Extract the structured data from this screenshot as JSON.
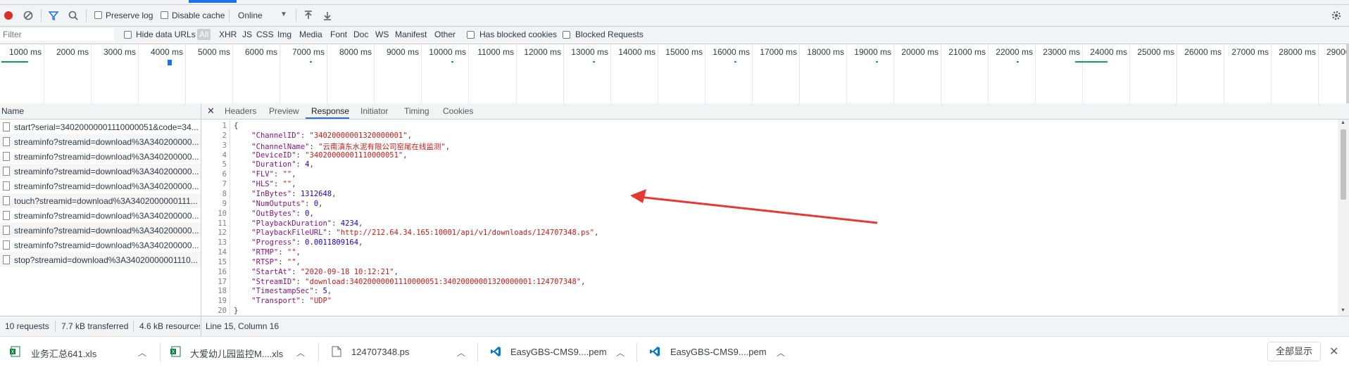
{
  "toolbar": {
    "preserve_log": "Preserve log",
    "disable_cache": "Disable cache",
    "throttle": "Online"
  },
  "filterbar": {
    "filter_placeholder": "Filter",
    "hide_data_urls": "Hide data URLs",
    "types": [
      "All",
      "XHR",
      "JS",
      "CSS",
      "Img",
      "Media",
      "Font",
      "Doc",
      "WS",
      "Manifest",
      "Other"
    ],
    "blocked_cookies": "Has blocked cookies",
    "blocked_requests": "Blocked Requests"
  },
  "timeline": {
    "ticks": [
      "1000 ms",
      "2000 ms",
      "3000 ms",
      "4000 ms",
      "5000 ms",
      "6000 ms",
      "7000 ms",
      "8000 ms",
      "9000 ms",
      "10000 ms",
      "11000 ms",
      "12000 ms",
      "13000 ms",
      "14000 ms",
      "15000 ms",
      "16000 ms",
      "17000 ms",
      "18000 ms",
      "19000 ms",
      "20000 ms",
      "21000 ms",
      "22000 ms",
      "23000 ms",
      "24000 ms",
      "25000 ms",
      "26000 ms",
      "27000 ms",
      "28000 ms",
      "29000"
    ]
  },
  "requests": {
    "header": "Name",
    "items": [
      "start?serial=34020000001110000051&code=34...",
      "streaminfo?streamid=download%3A340200000...",
      "streaminfo?streamid=download%3A340200000...",
      "streaminfo?streamid=download%3A340200000...",
      "streaminfo?streamid=download%3A340200000...",
      "touch?streamid=download%3A3402000000111...",
      "streaminfo?streamid=download%3A340200000...",
      "streaminfo?streamid=download%3A340200000...",
      "streaminfo?streamid=download%3A340200000...",
      "stop?streamid=download%3A34020000001110..."
    ]
  },
  "detail": {
    "tabs": [
      "Headers",
      "Preview",
      "Response",
      "Initiator",
      "Timing",
      "Cookies"
    ],
    "selected_tab": "Response",
    "line_numbers": [
      "1",
      "2",
      "3",
      "4",
      "5",
      "6",
      "7",
      "8",
      "9",
      "10",
      "11",
      "12",
      "13",
      "14",
      "15",
      "16",
      "17",
      "18",
      "19",
      "20"
    ],
    "lines": [
      {
        "type": "brace",
        "text": "{"
      },
      {
        "key": "\"ChannelID\"",
        "val": "\"34020000001320000001\"",
        "vtype": "s",
        "comma": ","
      },
      {
        "key": "\"ChannelName\"",
        "val": "\"云南滇东水泥有限公司窑尾在线监测\"",
        "vtype": "s",
        "comma": ","
      },
      {
        "key": "\"DeviceID\"",
        "val": "\"34020000001110000051\"",
        "vtype": "s",
        "comma": ","
      },
      {
        "key": "\"Duration\"",
        "val": "4",
        "vtype": "n",
        "comma": ","
      },
      {
        "key": "\"FLV\"",
        "val": "\"\"",
        "vtype": "s",
        "comma": ","
      },
      {
        "key": "\"HLS\"",
        "val": "\"\"",
        "vtype": "s",
        "comma": ","
      },
      {
        "key": "\"InBytes\"",
        "val": "1312648",
        "vtype": "n",
        "comma": ","
      },
      {
        "key": "\"NumOutputs\"",
        "val": "0",
        "vtype": "n",
        "comma": ","
      },
      {
        "key": "\"OutBytes\"",
        "val": "0",
        "vtype": "n",
        "comma": ","
      },
      {
        "key": "\"PlaybackDuration\"",
        "val": "4234",
        "vtype": "n",
        "comma": ","
      },
      {
        "key": "\"PlaybackFileURL\"",
        "val": "\"http://212.64.34.165:10001/api/v1/downloads/124707348.ps\"",
        "vtype": "s",
        "comma": ","
      },
      {
        "key": "\"Progress\"",
        "val": "0.0011809164",
        "vtype": "n",
        "comma": ","
      },
      {
        "key": "\"RTMP\"",
        "val": "\"\"",
        "vtype": "s",
        "comma": ","
      },
      {
        "key": "\"RTSP\"",
        "val": "\"\"",
        "vtype": "s",
        "comma": ","
      },
      {
        "key": "\"StartAt\"",
        "val": "\"2020-09-18 10:12:21\"",
        "vtype": "s",
        "comma": ","
      },
      {
        "key": "\"StreamID\"",
        "val": "\"download:34020000001110000051:34020000001320000001:124707348\"",
        "vtype": "s",
        "comma": ","
      },
      {
        "key": "\"TimestampSec\"",
        "val": "5",
        "vtype": "n",
        "comma": ","
      },
      {
        "key": "\"Transport\"",
        "val": "\"UDP\"",
        "vtype": "s",
        "comma": ""
      },
      {
        "type": "brace",
        "text": "}"
      }
    ]
  },
  "status": {
    "requests": "10 requests",
    "transferred": "7.7 kB transferred",
    "resources": "4.6 kB resources",
    "cursor": "Line 15, Column 16"
  },
  "downloads": {
    "items": [
      {
        "name": "业务汇总641.xls",
        "icon": "excel-file-icon"
      },
      {
        "name": "大爱幼儿园监控M....xls",
        "icon": "excel-file-icon"
      },
      {
        "name": "124707348.ps",
        "icon": "generic-file-icon"
      },
      {
        "name": "EasyGBS-CMS9....pem",
        "icon": "vscode-file-icon"
      },
      {
        "name": "EasyGBS-CMS9....pem",
        "icon": "vscode-file-icon"
      }
    ],
    "show_all": "全部显示"
  },
  "colors": {
    "record_red": "#d93025",
    "filter_blue": "#1a73e8",
    "arrow_red": "#e53935",
    "timeline_green": "#0f9d58"
  }
}
